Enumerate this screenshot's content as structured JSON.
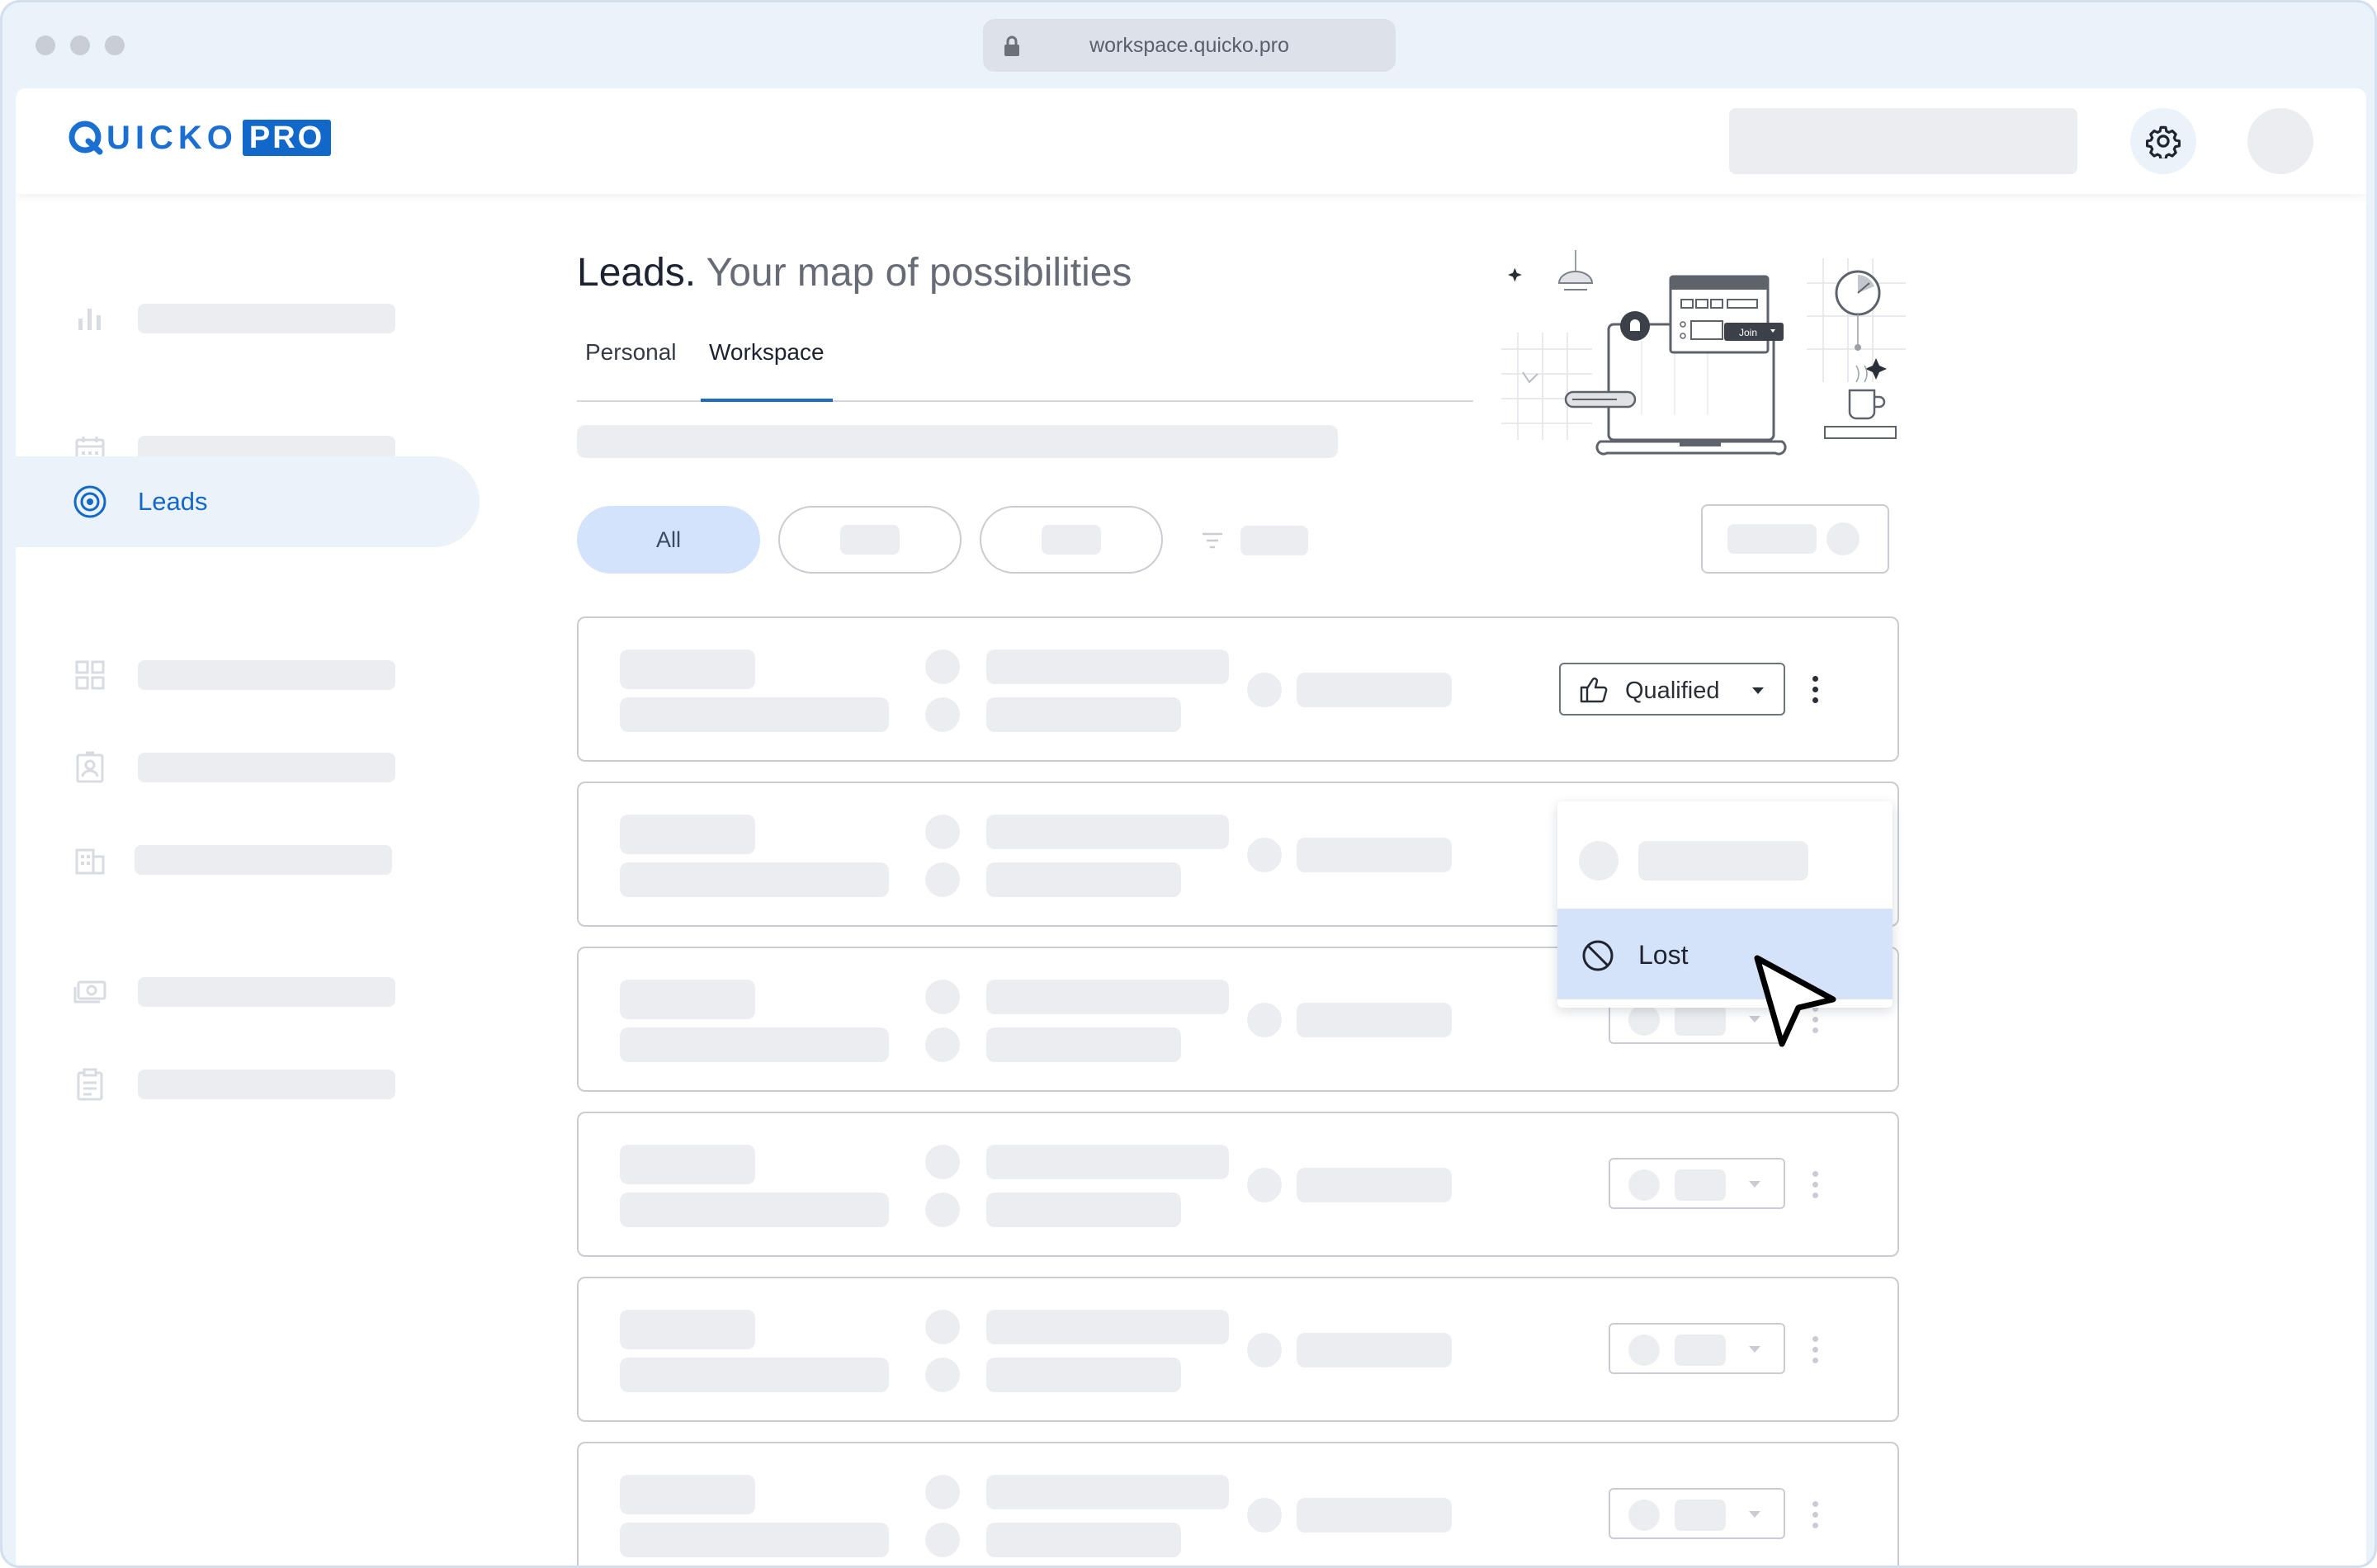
{
  "browser": {
    "url": "workspace.quicko.pro"
  },
  "header": {
    "logo_word": "UICKO",
    "logo_badge": "PRO",
    "logo_letter": "Q"
  },
  "sidebar": {
    "active_label": "Leads"
  },
  "page": {
    "title_strong": "Leads.",
    "title_soft": "Your map of possibilities",
    "tabs": [
      {
        "label": "Personal"
      },
      {
        "label": "Workspace"
      }
    ],
    "active_tab": "Workspace"
  },
  "filters": {
    "all_label": "All"
  },
  "first_row": {
    "status_label": "Qualified"
  },
  "dropdown": {
    "lost_label": "Lost"
  },
  "illustration": {
    "button_label": "Join"
  },
  "colors": {
    "accent": "#1f6bc4",
    "active_bg": "#eaf2fa",
    "chip_all_bg": "#d3e3fb",
    "dropdown_highlight": "#d5e3fa",
    "skeleton": "#ecedf1"
  },
  "icons": {
    "sidebar": [
      "bar-chart-icon",
      "calendar-icon",
      "target-icon",
      "grid-icon",
      "id-badge-icon",
      "building-icon",
      "cash-icon",
      "clipboard-icon"
    ],
    "header": [
      "gear-icon"
    ],
    "row": [
      "thumbs-up-icon",
      "chevron-down-icon",
      "kebab-menu-icon"
    ],
    "dropdown": [
      "ban-icon"
    ],
    "filters": [
      "filter-icon"
    ]
  }
}
